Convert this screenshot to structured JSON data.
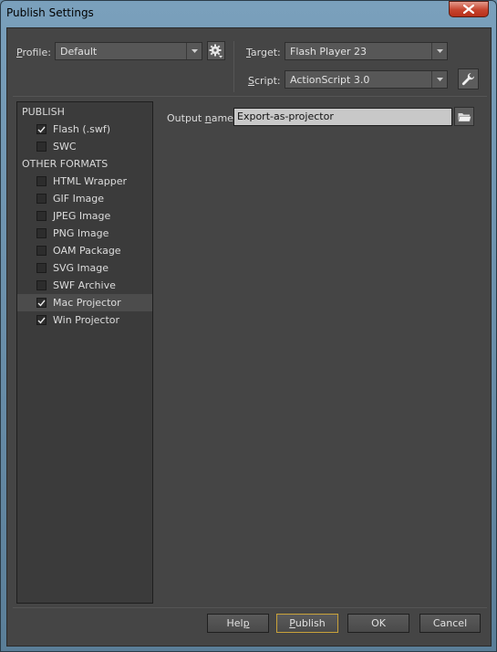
{
  "window": {
    "title": "Publish Settings"
  },
  "profile": {
    "label_pre": "",
    "label_ul": "P",
    "label_post": "rofile:",
    "value": "Default"
  },
  "target": {
    "label_pre": "",
    "label_ul": "T",
    "label_post": "arget:",
    "value": "Flash Player 23"
  },
  "script": {
    "label_pre": "",
    "label_ul": "S",
    "label_post": "cript:",
    "value": "ActionScript 3.0"
  },
  "formats": {
    "publish_heading": "PUBLISH",
    "other_heading": "OTHER FORMATS",
    "publish_items": [
      {
        "label": "Flash (.swf)",
        "checked": true
      },
      {
        "label": "SWC",
        "checked": false
      }
    ],
    "other_items": [
      {
        "label": "HTML Wrapper",
        "checked": false
      },
      {
        "label": "GIF Image",
        "checked": false
      },
      {
        "label": "JPEG Image",
        "checked": false
      },
      {
        "label": "PNG Image",
        "checked": false
      },
      {
        "label": "OAM Package",
        "checked": false
      },
      {
        "label": "SVG Image",
        "checked": false
      },
      {
        "label": "SWF Archive",
        "checked": false
      },
      {
        "label": "Mac Projector",
        "checked": true
      },
      {
        "label": "Win Projector",
        "checked": true
      }
    ]
  },
  "output": {
    "label_pre": "Output ",
    "label_ul": "n",
    "label_post": "ame:",
    "value": "Export-as-projector"
  },
  "buttons": {
    "help": {
      "pre": "Hel",
      "ul": "p",
      "post": ""
    },
    "publish": {
      "pre": "",
      "ul": "P",
      "post": "ublish"
    },
    "ok": "OK",
    "cancel": "Cancel"
  }
}
